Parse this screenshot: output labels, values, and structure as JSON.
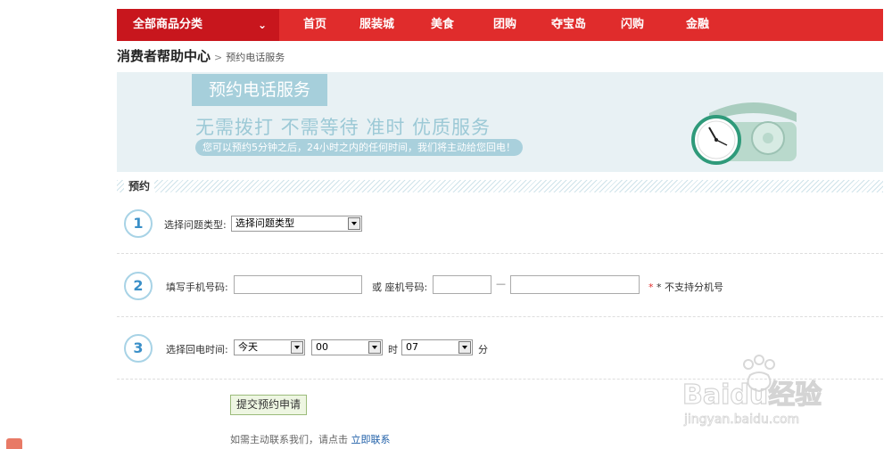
{
  "nav": {
    "category_label": "全部商品分类",
    "items": [
      "首页",
      "服装城",
      "美食",
      "团购",
      "夺宝岛",
      "闪购",
      "金融"
    ]
  },
  "breadcrumb": {
    "title": "消费者帮助中心",
    "separator": ">",
    "current": "预约电话服务"
  },
  "banner": {
    "tag": "预约电话服务",
    "headline": "无需拨打 不需等待 准时 优质服务",
    "subline": "您可以预约5分钟之后，24小时之内的任何时间，我们将主动给您回电！"
  },
  "section": {
    "title": "预约"
  },
  "step1": {
    "number": "1",
    "label": "选择问题类型:",
    "select_value": "选择问题类型"
  },
  "step2": {
    "number": "2",
    "mobile_label": "填写手机号码:",
    "landline_label": "或 座机号码:",
    "dash": "—",
    "note": "* 不支持分机号"
  },
  "step3": {
    "number": "3",
    "label": "选择回电时间:",
    "day_value": "今天",
    "hour_value": "00",
    "hour_unit": "时",
    "minute_value": "07",
    "minute_unit": "分"
  },
  "submit": {
    "label": "提交预约申请"
  },
  "hint": {
    "text": "如需主动联系我们，请点击",
    "link": "立即联系"
  },
  "watermark": {
    "brand": "Baidu经验",
    "url": "jingyan.baidu.com"
  },
  "colors": {
    "nav_red": "#e02c2c",
    "nav_dark_red": "#c8161d",
    "banner_bg": "#e8f1f4",
    "step_blue": "#3a8fc8"
  }
}
